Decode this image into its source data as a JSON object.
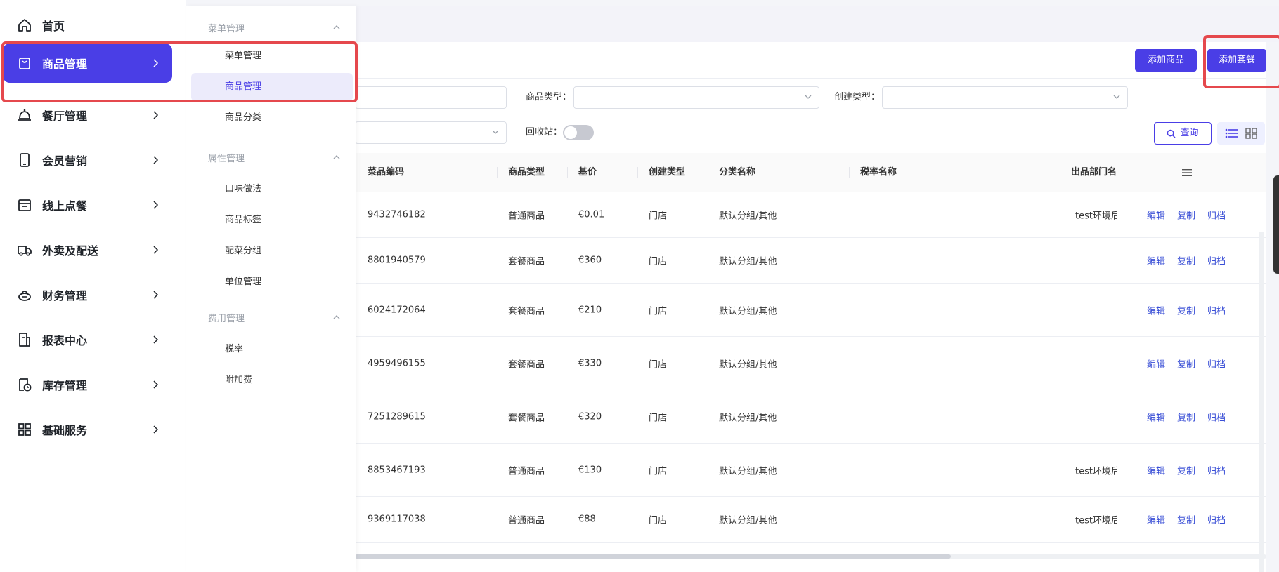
{
  "sidebar": {
    "items": [
      {
        "label": "首页",
        "icon": "home-icon",
        "has_arrow": false
      },
      {
        "label": "商品管理",
        "icon": "bag-icon",
        "has_arrow": true,
        "active": true
      },
      {
        "label": "餐厅管理",
        "icon": "bell-icon",
        "has_arrow": true
      },
      {
        "label": "会员营销",
        "icon": "phone-icon",
        "has_arrow": true
      },
      {
        "label": "线上点餐",
        "icon": "store-icon",
        "has_arrow": true
      },
      {
        "label": "外卖及配送",
        "icon": "truck-icon",
        "has_arrow": true
      },
      {
        "label": "财务管理",
        "icon": "money-icon",
        "has_arrow": true
      },
      {
        "label": "报表中心",
        "icon": "report-icon",
        "has_arrow": true
      },
      {
        "label": "库存管理",
        "icon": "inventory-icon",
        "has_arrow": true
      },
      {
        "label": "基础服务",
        "icon": "grid-icon",
        "has_arrow": true
      }
    ]
  },
  "submenu": {
    "groups": [
      {
        "title": "菜单管理",
        "items": [
          "菜单管理",
          "商品管理",
          "商品分类"
        ]
      },
      {
        "title": "属性管理",
        "items": [
          "口味做法",
          "商品标签",
          "配菜分组",
          "单位管理"
        ]
      },
      {
        "title": "费用管理",
        "items": [
          "税率",
          "附加费"
        ]
      }
    ],
    "active_item": "商品管理"
  },
  "toolbar": {
    "add_product": "添加商品",
    "add_set": "添加套餐"
  },
  "filters": {
    "product_type_label": "商品类型：",
    "create_type_label": "创建类型：",
    "recycle_label": "回收站：",
    "query_button": "查询"
  },
  "table": {
    "columns": [
      "菜品编码",
      "商品类型",
      "基价",
      "创建类型",
      "分类名称",
      "税率名称",
      "出品部门名"
    ],
    "actions": [
      "编辑",
      "复制",
      "归档"
    ],
    "rows": [
      {
        "code": "9432746182",
        "type": "普通商品",
        "price": "€0.01",
        "create": "门店",
        "category": "默认分组/其他",
        "tax": "",
        "dept": "test环境后"
      },
      {
        "code": "8801940579",
        "type": "套餐商品",
        "price": "€360",
        "create": "门店",
        "category": "默认分组/其他",
        "tax": "",
        "dept": ""
      },
      {
        "code": "6024172064",
        "type": "套餐商品",
        "price": "€210",
        "create": "门店",
        "category": "默认分组/其他",
        "tax": "",
        "dept": ""
      },
      {
        "code": "4959496155",
        "type": "套餐商品",
        "price": "€330",
        "create": "门店",
        "category": "默认分组/其他",
        "tax": "",
        "dept": ""
      },
      {
        "code": "7251289615",
        "type": "套餐商品",
        "price": "€320",
        "create": "门店",
        "category": "默认分组/其他",
        "tax": "",
        "dept": ""
      },
      {
        "code": "8853467193",
        "type": "普通商品",
        "price": "€130",
        "create": "门店",
        "category": "默认分组/其他",
        "tax": "",
        "dept": "test环境后"
      },
      {
        "code": "9369117038",
        "type": "普通商品",
        "price": "€88",
        "create": "门店",
        "category": "默认分组/其他",
        "tax": "",
        "dept": "test环境后"
      }
    ]
  },
  "colors": {
    "accent": "#4a3ee6",
    "highlight": "#e5484d",
    "link": "#3a4fd6"
  }
}
